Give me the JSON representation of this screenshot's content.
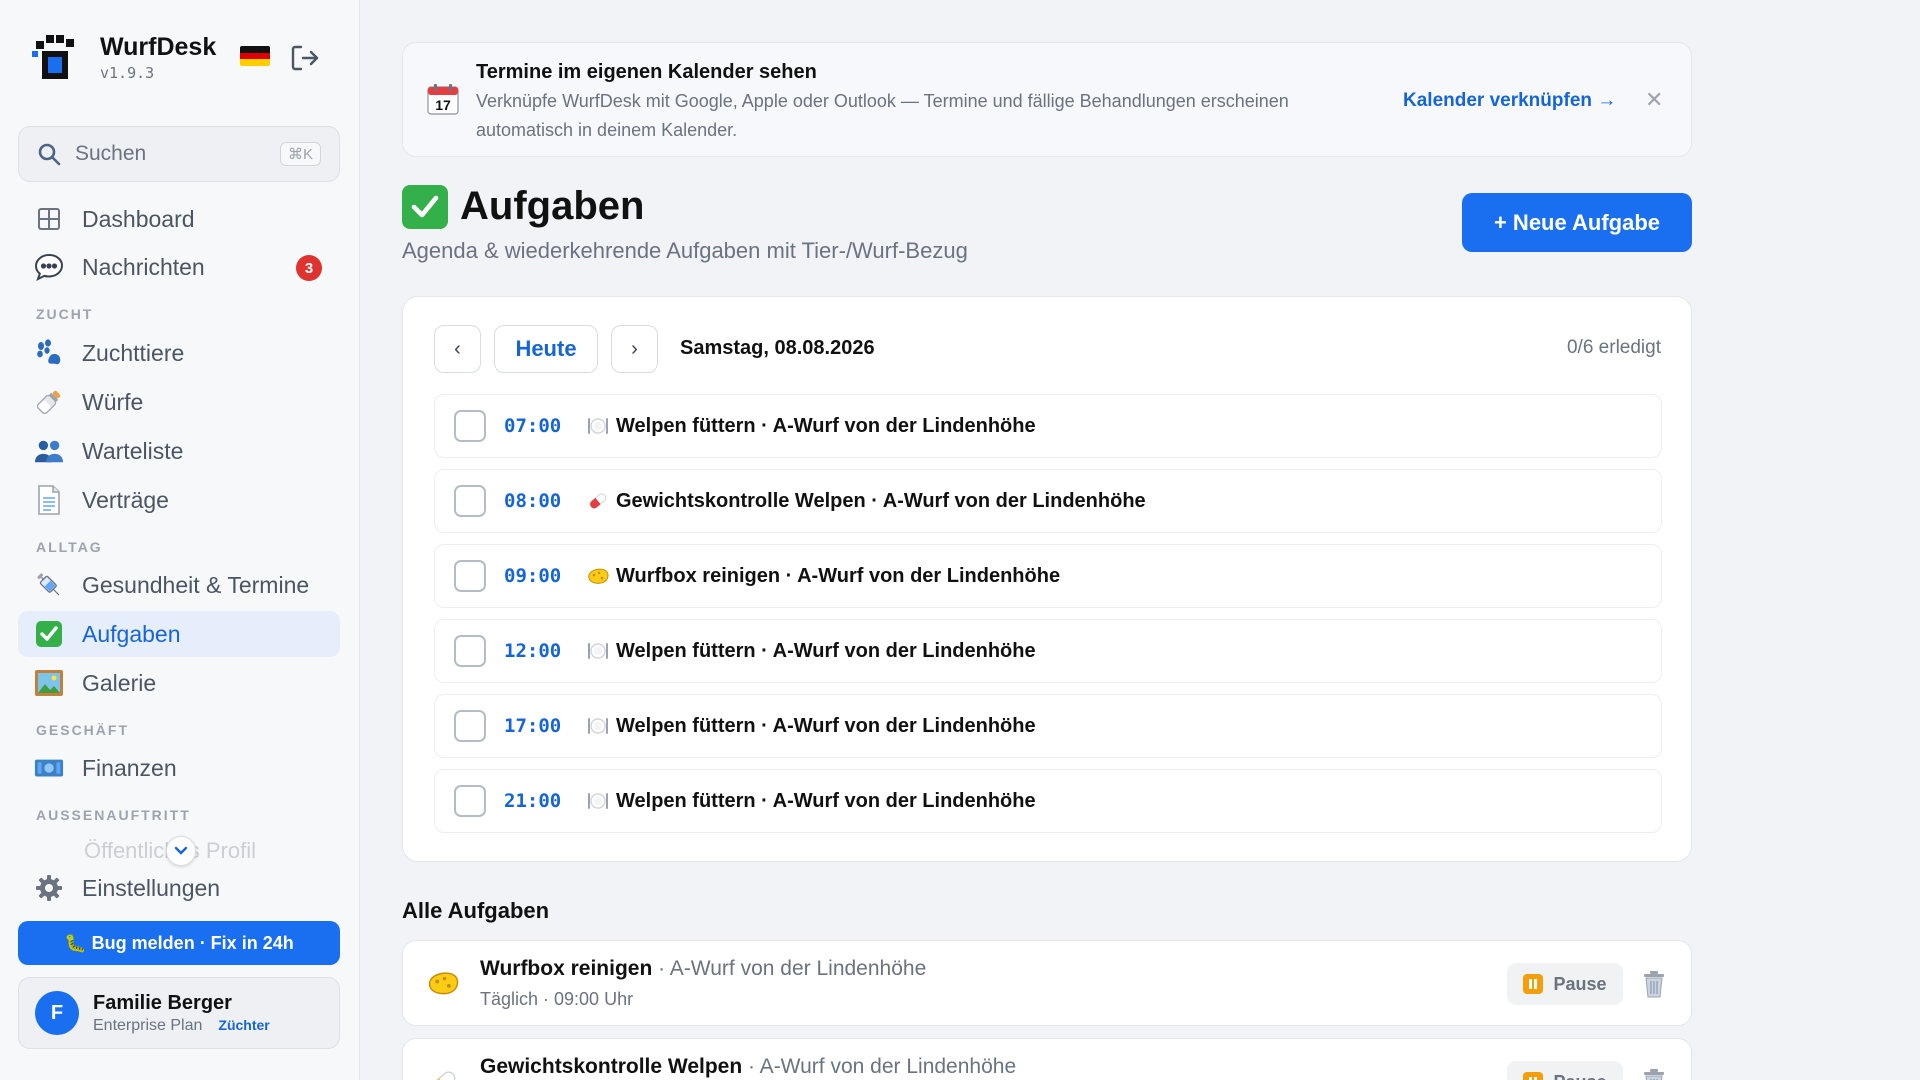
{
  "app": {
    "name": "WurfDesk",
    "version": "v1.9.3"
  },
  "colors": {
    "accent": "#1a6ef0",
    "accent_text": "#1565d8",
    "badge": "#e0322f",
    "check_green": "#34b04a"
  },
  "search": {
    "placeholder": "Suchen",
    "shortcut": "⌘K"
  },
  "sidebar": {
    "items": [
      {
        "label": "Dashboard",
        "icon": "grid-icon"
      },
      {
        "label": "Nachrichten",
        "icon": "speech-bubble-icon",
        "badge": "3"
      },
      {
        "label": "Zuchttiere",
        "icon": "paw-icon"
      },
      {
        "label": "Würfe",
        "icon": "baby-bottle-icon"
      },
      {
        "label": "Warteliste",
        "icon": "people-icon"
      },
      {
        "label": "Verträge",
        "icon": "document-icon"
      },
      {
        "label": "Gesundheit & Termine",
        "icon": "syringe-icon"
      },
      {
        "label": "Aufgaben",
        "icon": "check-box-icon",
        "active": true
      },
      {
        "label": "Galerie",
        "icon": "picture-icon"
      },
      {
        "label": "Finanzen",
        "icon": "money-icon"
      },
      {
        "label": "Öffentliches Profil",
        "icon": "globe-icon"
      },
      {
        "label": "Einstellungen",
        "icon": "gear-icon"
      }
    ],
    "sections": [
      "ZUCHT",
      "ALLTAG",
      "GESCHÄFT",
      "AUSSENAUFTRITT"
    ],
    "bug_button": "🐛 Bug melden · Fix in 24h",
    "user": {
      "initial": "F",
      "name": "Familie Berger",
      "plan": "Enterprise Plan",
      "role": "Züchter"
    }
  },
  "banner": {
    "title": "Termine im eigenen Kalender sehen",
    "text": "Verknüpfe WurfDesk mit Google, Apple oder Outlook — Termine und fällige Behandlungen erscheinen automatisch in deinem Kalender.",
    "link": "Kalender verknüpfen →",
    "close": "✕",
    "calendar_day": "17"
  },
  "page": {
    "title": "Aufgaben",
    "subtitle": "Agenda & wiederkehrende Aufgaben mit Tier-/Wurf-Bezug",
    "new_button": "+ Neue Aufgabe"
  },
  "agenda": {
    "today_label": "Heute",
    "prev": "‹",
    "next": "›",
    "date": "Samstag, 08.08.2026",
    "count": "0/6 erledigt",
    "tasks": [
      {
        "time": "07:00",
        "icon": "plate-icon",
        "label": "Welpen füttern · A-Wurf von der Lindenhöhe",
        "done": false
      },
      {
        "time": "08:00",
        "icon": "pill-icon",
        "label": "Gewichtskontrolle Welpen · A-Wurf von der Lindenhöhe",
        "done": false
      },
      {
        "time": "09:00",
        "icon": "sponge-icon",
        "label": "Wurfbox reinigen · A-Wurf von der Lindenhöhe",
        "done": false
      },
      {
        "time": "12:00",
        "icon": "plate-icon",
        "label": "Welpen füttern · A-Wurf von der Lindenhöhe",
        "done": false
      },
      {
        "time": "17:00",
        "icon": "plate-icon",
        "label": "Welpen füttern · A-Wurf von der Lindenhöhe",
        "done": false
      },
      {
        "time": "21:00",
        "icon": "plate-icon",
        "label": "Welpen füttern · A-Wurf von der Lindenhöhe",
        "done": false
      }
    ]
  },
  "all_tasks": {
    "title": "Alle Aufgaben",
    "items": [
      {
        "title": "Wurfbox reinigen",
        "litter": "· A-Wurf von der Lindenhöhe",
        "schedule": "Täglich · 09:00 Uhr",
        "pause": "Pause",
        "icon": "sponge-icon"
      },
      {
        "title": "Gewichtskontrolle Welpen",
        "litter": "· A-Wurf von der Lindenhöhe",
        "schedule": "",
        "pause": "Pause",
        "icon": "pill-icon"
      }
    ]
  }
}
